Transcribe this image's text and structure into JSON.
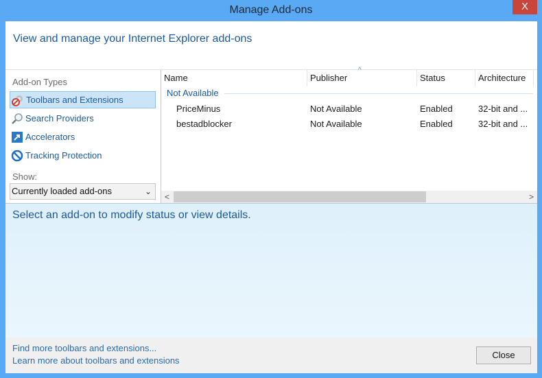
{
  "window": {
    "title": "Manage Add-ons",
    "close_glyph": "X"
  },
  "header": {
    "text": "View and manage your Internet Explorer add-ons"
  },
  "sidebar": {
    "types_label": "Add-on Types",
    "items": [
      {
        "label": "Toolbars and Extensions",
        "icon": "gear-blocked-icon",
        "selected": true
      },
      {
        "label": "Search Providers",
        "icon": "magnifier-icon",
        "selected": false
      },
      {
        "label": "Accelerators",
        "icon": "accelerator-arrow-icon",
        "selected": false
      },
      {
        "label": "Tracking Protection",
        "icon": "no-entry-icon",
        "selected": false
      }
    ],
    "show_label": "Show:",
    "show_value": "Currently loaded add-ons"
  },
  "list": {
    "columns": [
      "Name",
      "Publisher",
      "Status",
      "Architecture"
    ],
    "sort_indicator": "^",
    "group": "Not Available",
    "rows": [
      {
        "name": "PriceMinus",
        "publisher": "Not Available",
        "status": "Enabled",
        "architecture": "32-bit and ..."
      },
      {
        "name": "bestadblocker",
        "publisher": "Not Available",
        "status": "Enabled",
        "architecture": "32-bit and ..."
      }
    ],
    "scroll_left": "<",
    "scroll_right": ">"
  },
  "details": {
    "text": "Select an add-on to modify status or view details."
  },
  "footer": {
    "link1": "Find more toolbars and extensions...",
    "link2": "Learn more about toolbars and extensions",
    "close_label": "Close"
  }
}
